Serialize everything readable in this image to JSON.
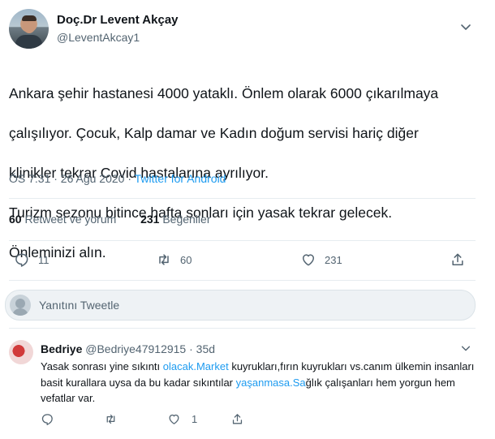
{
  "tweet": {
    "author_name": "Doç.Dr Levent Akçay",
    "author_handle": "@LeventAkcay1",
    "text_lines": [
      "Ankara şehir hastanesi 4000 yataklı. Önlem olarak 6000 çıkarılmaya",
      "çalışılıyor. Çocuk, Kalp damar ve Kadın doğum servisi hariç diğer",
      "klinikler tekrar Covid hastalarına ayrılıyor.",
      "Turizm sezonu bitince hafta sonları için yasak tekrar gelecek.",
      "Önleminizi alın."
    ],
    "timestamp": "ÖS 7:31 · 26 Ağu 2020 · ",
    "source_app": "Twitter for Android",
    "stats": {
      "retweets_count": "60",
      "retweets_label": " Retweet ve yorum",
      "likes_count": "231",
      "likes_label": " Beğeniler"
    },
    "actions": {
      "reply_count": "11",
      "retweet_count": "60",
      "like_count": "231"
    }
  },
  "reply_box": {
    "placeholder": "Yanıtını Tweetle"
  },
  "reply": {
    "author_name": "Bedriye",
    "author_handle": "@Bedriye47912915",
    "time": "· 35d",
    "text_part1": "Yasak sonrası yine sıkıntı ",
    "link1": "olacak.Market",
    "text_part2": " kuyrukları,fırın kuyrukları vs.canım ülkemin insanları basit kurallara uysa da bu kadar sıkıntılar ",
    "link2": "yaşanmasa.Sa",
    "text_part3": "ğlık çalışanları hem yorgun hem vefatlar var.",
    "actions": {
      "like_count": "1"
    }
  },
  "colors": {
    "accent": "#1d9bf0",
    "secondary_text": "#536471",
    "divider": "#e6ecf0"
  },
  "icons": [
    "chevron-down-icon",
    "reply-icon",
    "retweet-icon",
    "heart-icon",
    "share-icon"
  ]
}
